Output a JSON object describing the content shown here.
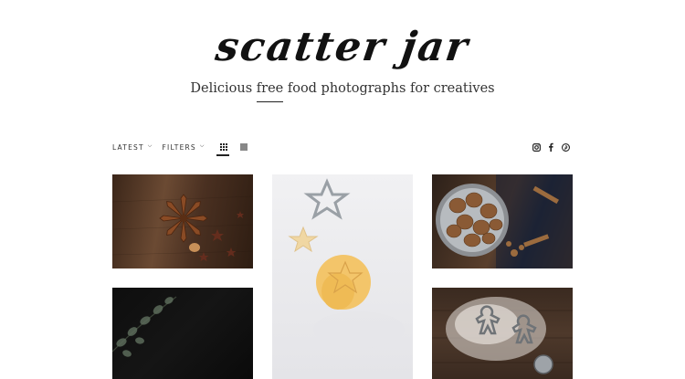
{
  "header": {
    "logo": "scatter jar",
    "tagline_before": "Delicious ",
    "tagline_highlight": "free",
    "tagline_after": " food photographs for creatives"
  },
  "toolbar": {
    "sort_label": "LATEST",
    "filters_label": "FILTERS",
    "active_view": "grid"
  },
  "social": [
    "instagram-icon",
    "facebook-icon",
    "pinterest-icon"
  ],
  "gallery": [
    {
      "name": "photo-star-anise"
    },
    {
      "name": "photo-cookie-dough-star-cutter"
    },
    {
      "name": "photo-walnuts-bowl"
    },
    {
      "name": "photo-eucalyptus-dark"
    },
    {
      "name": "photo-floured-gingerbread-cutters"
    }
  ],
  "colors": {
    "background": "#ffffff",
    "text": "#222222",
    "muted_icon": "#888888"
  }
}
